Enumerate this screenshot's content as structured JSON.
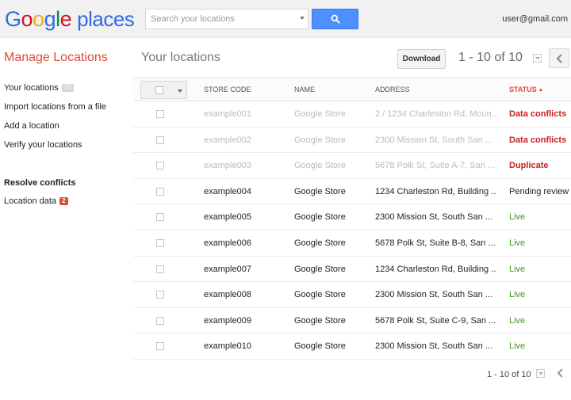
{
  "header": {
    "logo_google": [
      "G",
      "o",
      "o",
      "g",
      "l",
      "e"
    ],
    "logo_product": "places",
    "search_placeholder": "Search your locations",
    "user_email": "user@gmail.com"
  },
  "sidebar": {
    "title": "Manage Locations",
    "your_locations": "Your locations",
    "your_locations_count": "10",
    "import": "Import locations from a file",
    "add": "Add a location",
    "verify": "Verify your locations",
    "resolve_heading": "Resolve conflicts",
    "location_data": "Location data",
    "location_data_count": "2"
  },
  "main": {
    "title": "Your locations",
    "download_label": "Download",
    "pager_top": "1 - 10 of 10",
    "pager_bottom": "1 - 10 of 10"
  },
  "table": {
    "headers": {
      "store_code": "Store code",
      "name": "Name",
      "address": "Address",
      "status": "Status"
    },
    "rows": [
      {
        "code": "example001",
        "name": "Google Store",
        "address": "2 / 1234 Charleston Rd, Moun...",
        "status": "Data conflicts",
        "status_type": "conflict",
        "dim": true
      },
      {
        "code": "example002",
        "name": "Google Store",
        "address": "2300 Mission St, South San ...",
        "status": "Data conflicts",
        "status_type": "conflict",
        "dim": true
      },
      {
        "code": "example003",
        "name": "Google Store",
        "address": "5678 Polk St, Suite A-7, San ...",
        "status": "Duplicate",
        "status_type": "conflict",
        "dim": true
      },
      {
        "code": "example004",
        "name": "Google Store",
        "address": "1234 Charleston Rd, Building ...",
        "status": "Pending review",
        "status_type": "pending",
        "dim": false
      },
      {
        "code": "example005",
        "name": "Google Store",
        "address": "2300 Mission St, South San ...",
        "status": "Live",
        "status_type": "live",
        "dim": false
      },
      {
        "code": "example006",
        "name": "Google Store",
        "address": "5678 Polk St, Suite B-8, San ...",
        "status": "Live",
        "status_type": "live",
        "dim": false
      },
      {
        "code": "example007",
        "name": "Google Store",
        "address": "1234 Charleston Rd, Building ...",
        "status": "Live",
        "status_type": "live",
        "dim": false
      },
      {
        "code": "example008",
        "name": "Google Store",
        "address": "2300 Mission St, South San ...",
        "status": "Live",
        "status_type": "live",
        "dim": false
      },
      {
        "code": "example009",
        "name": "Google Store",
        "address": "5678 Polk St, Suite C-9, San ...",
        "status": "Live",
        "status_type": "live",
        "dim": false
      },
      {
        "code": "example010",
        "name": "Google Store",
        "address": "2300 Mission St, South San ...",
        "status": "Live",
        "status_type": "live",
        "dim": false
      }
    ]
  },
  "colors": {
    "accent_red": "#dd4b39",
    "search_blue": "#4d90fe",
    "live_green": "#3d9a1b",
    "conflict_red": "#c5221f"
  },
  "icons": {
    "search": "search-icon",
    "chevron_left": "chevron-left-icon",
    "dropdown": "chevron-down-icon"
  }
}
